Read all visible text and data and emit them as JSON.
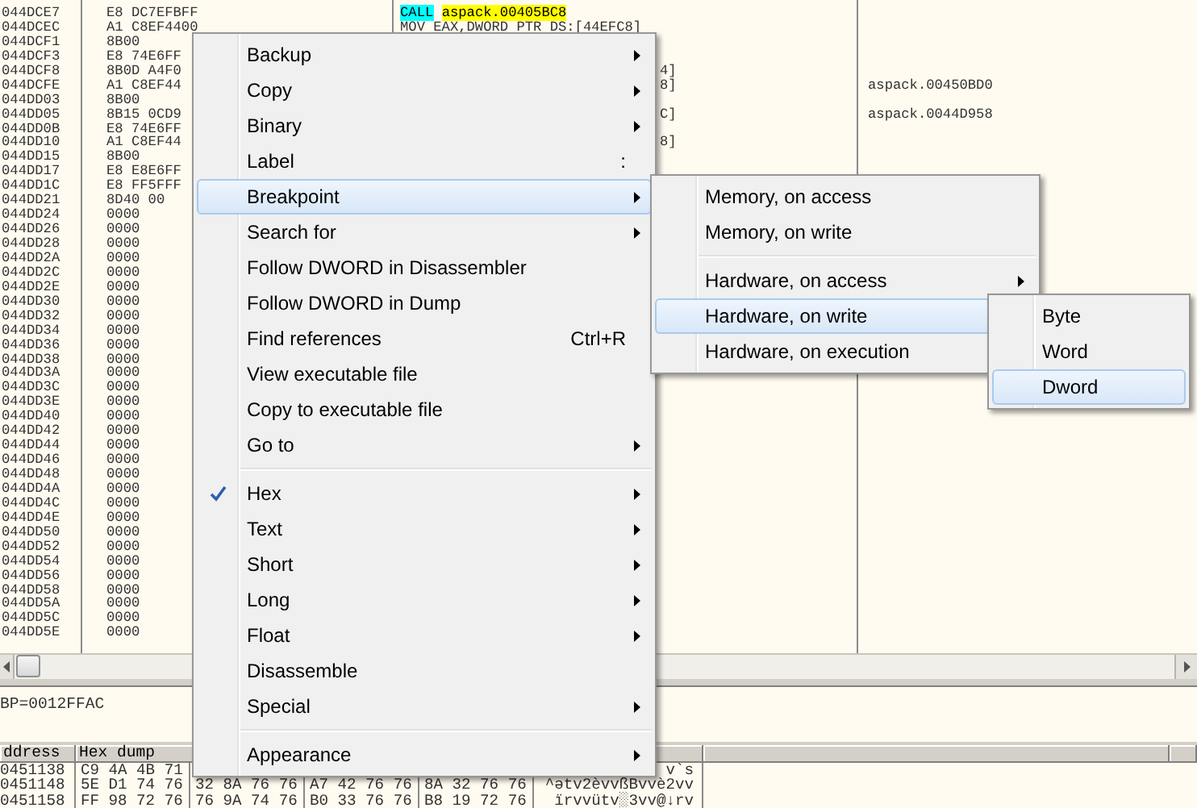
{
  "disassembly": {
    "rows": [
      {
        "address": "044DCE7",
        "hex": "E8 DC7EFBFF",
        "code": [
          {
            "text": "CALL",
            "kind": "call"
          },
          {
            "text": "aspack.00405BC8",
            "kind": "target"
          }
        ]
      },
      {
        "address": "044DCEC",
        "hex": "A1 C8EF4400",
        "code": [
          {
            "text": "MOV EAX,DWORD PTR DS:[44EFC8]",
            "kind": "plain"
          }
        ]
      },
      {
        "address": "044DCF1",
        "hex": "8B00"
      },
      {
        "address": "044DCF3",
        "hex": "E8 74E6FF"
      },
      {
        "address": "044DCF8",
        "hex": "8B0D A4F0",
        "code": [
          {
            "text": "4]",
            "kind": "tail"
          }
        ]
      },
      {
        "address": "044DCFE",
        "hex": "A1 C8EF44",
        "code": [
          {
            "text": "8]",
            "kind": "tail"
          }
        ],
        "comment": "aspack.00450BD0"
      },
      {
        "address": "044DD03",
        "hex": "8B00"
      },
      {
        "address": "044DD05",
        "hex": "8B15 0CD9",
        "code": [
          {
            "text": "C]",
            "kind": "tail"
          }
        ],
        "comment": "aspack.0044D958"
      },
      {
        "address": "044DD0B",
        "hex": "E8 74E6FF"
      },
      {
        "address": "044DD10",
        "hex": "A1 C8EF44",
        "code": [
          {
            "text": "8]",
            "kind": "tail"
          }
        ]
      },
      {
        "address": "044DD15",
        "hex": "8B00"
      },
      {
        "address": "044DD17",
        "hex": "E8 E8E6FF"
      },
      {
        "address": "044DD1C",
        "hex": "E8 FF5FFF"
      },
      {
        "address": "044DD21",
        "hex": "8D40 00"
      },
      {
        "address": "044DD24",
        "hex": "0000"
      },
      {
        "address": "044DD26",
        "hex": "0000"
      },
      {
        "address": "044DD28",
        "hex": "0000"
      },
      {
        "address": "044DD2A",
        "hex": "0000"
      },
      {
        "address": "044DD2C",
        "hex": "0000"
      },
      {
        "address": "044DD2E",
        "hex": "0000"
      },
      {
        "address": "044DD30",
        "hex": "0000"
      },
      {
        "address": "044DD32",
        "hex": "0000"
      },
      {
        "address": "044DD34",
        "hex": "0000"
      },
      {
        "address": "044DD36",
        "hex": "0000"
      },
      {
        "address": "044DD38",
        "hex": "0000"
      },
      {
        "address": "044DD3A",
        "hex": "0000"
      },
      {
        "address": "044DD3C",
        "hex": "0000"
      },
      {
        "address": "044DD3E",
        "hex": "0000"
      },
      {
        "address": "044DD40",
        "hex": "0000"
      },
      {
        "address": "044DD42",
        "hex": "0000"
      },
      {
        "address": "044DD44",
        "hex": "0000"
      },
      {
        "address": "044DD46",
        "hex": "0000"
      },
      {
        "address": "044DD48",
        "hex": "0000"
      },
      {
        "address": "044DD4A",
        "hex": "0000"
      },
      {
        "address": "044DD4C",
        "hex": "0000"
      },
      {
        "address": "044DD4E",
        "hex": "0000"
      },
      {
        "address": "044DD50",
        "hex": "0000"
      },
      {
        "address": "044DD52",
        "hex": "0000"
      },
      {
        "address": "044DD54",
        "hex": "0000"
      },
      {
        "address": "044DD56",
        "hex": "0000"
      },
      {
        "address": "044DD58",
        "hex": "0000"
      },
      {
        "address": "044DD5A",
        "hex": "0000"
      },
      {
        "address": "044DD5C",
        "hex": "0000"
      },
      {
        "address": "044DD5E",
        "hex": "0000"
      }
    ]
  },
  "registers": {
    "text": "BP=0012FFAC"
  },
  "dump": {
    "columns": [
      "ddress",
      "Hex dump"
    ],
    "rows": [
      {
        "address": "0451138",
        "hex": [
          "C9 4A 4B 71"
        ],
        "ascii": "v`s"
      },
      {
        "address": "0451148",
        "hex": [
          "5E D1 74 76",
          "32 8A 76 76",
          "A7 42 76 76",
          "8A 32 76 76"
        ],
        "ascii": "^ətv2èvvßBvvè2vv"
      },
      {
        "address": "0451158",
        "hex": [
          "FF 98 72 76",
          "76 9A 74 76",
          "B0 33 76 76",
          "B8 19 72 76"
        ],
        "ascii": "ïrvvütv░3vv@↓rv"
      }
    ]
  },
  "context_menu": {
    "groups": [
      {
        "items": [
          {
            "label": "Backup",
            "selected": false,
            "checked": false,
            "has_submenu": true
          },
          {
            "label": "Copy",
            "selected": false,
            "checked": false,
            "has_submenu": true
          },
          {
            "label": "Binary",
            "selected": false,
            "checked": false,
            "has_submenu": true
          },
          {
            "label": "Label",
            "shortcut": ":",
            "selected": false,
            "checked": false,
            "has_submenu": false
          },
          {
            "label": "Breakpoint",
            "selected": true,
            "checked": false,
            "has_submenu": true,
            "submenu": {
              "groups": [
                {
                  "items": [
                    {
                      "label": "Memory, on access",
                      "selected": false,
                      "has_submenu": false
                    },
                    {
                      "label": "Memory, on write",
                      "selected": false,
                      "has_submenu": false
                    }
                  ]
                },
                {
                  "items": [
                    {
                      "label": "Hardware, on access",
                      "selected": false,
                      "has_submenu": true
                    },
                    {
                      "label": "Hardware, on write",
                      "selected": true,
                      "has_submenu": true,
                      "submenu": {
                        "groups": [
                          {
                            "items": [
                              {
                                "label": "Byte",
                                "selected": false,
                                "has_submenu": false
                              },
                              {
                                "label": "Word",
                                "selected": false,
                                "has_submenu": false
                              },
                              {
                                "label": "Dword",
                                "selected": true,
                                "has_submenu": false
                              }
                            ]
                          }
                        ]
                      }
                    },
                    {
                      "label": "Hardware, on execution",
                      "selected": false,
                      "has_submenu": false
                    }
                  ]
                }
              ]
            }
          },
          {
            "label": "Search for",
            "selected": false,
            "checked": false,
            "has_submenu": true
          },
          {
            "label": "Follow DWORD in Disassembler",
            "selected": false,
            "checked": false,
            "has_submenu": false
          },
          {
            "label": "Follow DWORD in Dump",
            "selected": false,
            "checked": false,
            "has_submenu": false
          },
          {
            "label": "Find references",
            "shortcut": "Ctrl+R",
            "selected": false,
            "checked": false,
            "has_submenu": false
          },
          {
            "label": "View executable file",
            "selected": false,
            "checked": false,
            "has_submenu": false
          },
          {
            "label": "Copy to executable file",
            "selected": false,
            "checked": false,
            "has_submenu": false
          },
          {
            "label": "Go to",
            "selected": false,
            "checked": false,
            "has_submenu": true
          }
        ]
      },
      {
        "items": [
          {
            "label": "Hex",
            "selected": false,
            "checked": true,
            "has_submenu": true
          },
          {
            "label": "Text",
            "selected": false,
            "checked": false,
            "has_submenu": true
          },
          {
            "label": "Short",
            "selected": false,
            "checked": false,
            "has_submenu": true
          },
          {
            "label": "Long",
            "selected": false,
            "checked": false,
            "has_submenu": true
          },
          {
            "label": "Float",
            "selected": false,
            "checked": false,
            "has_submenu": true
          },
          {
            "label": "Disassemble",
            "selected": false,
            "checked": false,
            "has_submenu": false
          },
          {
            "label": "Special",
            "selected": false,
            "checked": false,
            "has_submenu": true
          }
        ]
      },
      {
        "items": [
          {
            "label": "Appearance",
            "selected": false,
            "checked": false,
            "has_submenu": true
          }
        ]
      }
    ]
  }
}
